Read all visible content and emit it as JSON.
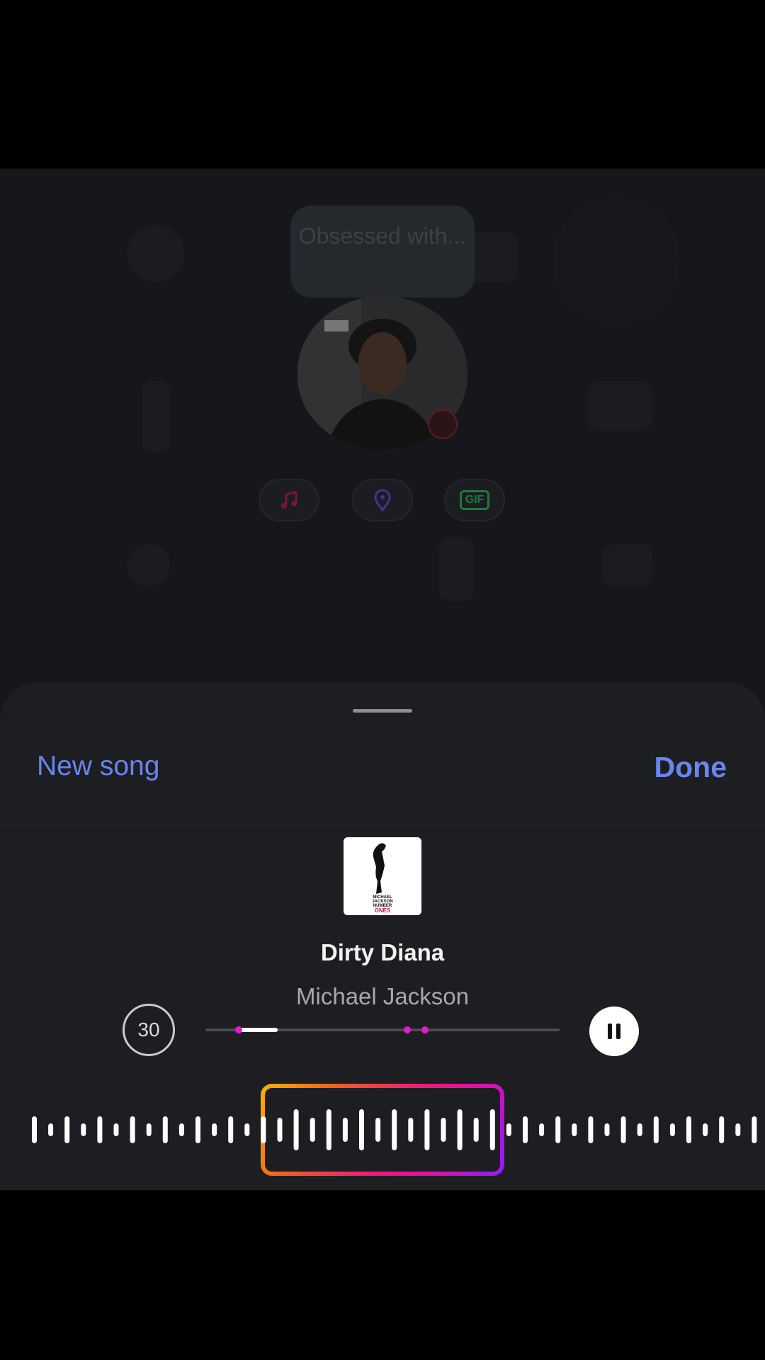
{
  "background": {
    "caption_placeholder": "Obsessed with..."
  },
  "stickers": [
    {
      "name": "music",
      "icon": "music-note-icon",
      "color": "#7a1630"
    },
    {
      "name": "location",
      "icon": "location-pin-icon",
      "color": "#4a2f8c"
    },
    {
      "name": "gif",
      "icon": "gif-icon",
      "label": "GIF",
      "color": "#1f7a3a"
    }
  ],
  "sheet": {
    "new_song_label": "New song",
    "done_label": "Done",
    "song_title": "Dirty Diana",
    "artist": "Michael Jackson",
    "duration_label": "30",
    "progress_fraction": 0.2,
    "accent": "#6a84f0"
  },
  "album_art": {
    "text": [
      "MICHAEL",
      "JACKSON",
      "NUMBER",
      "ONES"
    ]
  }
}
